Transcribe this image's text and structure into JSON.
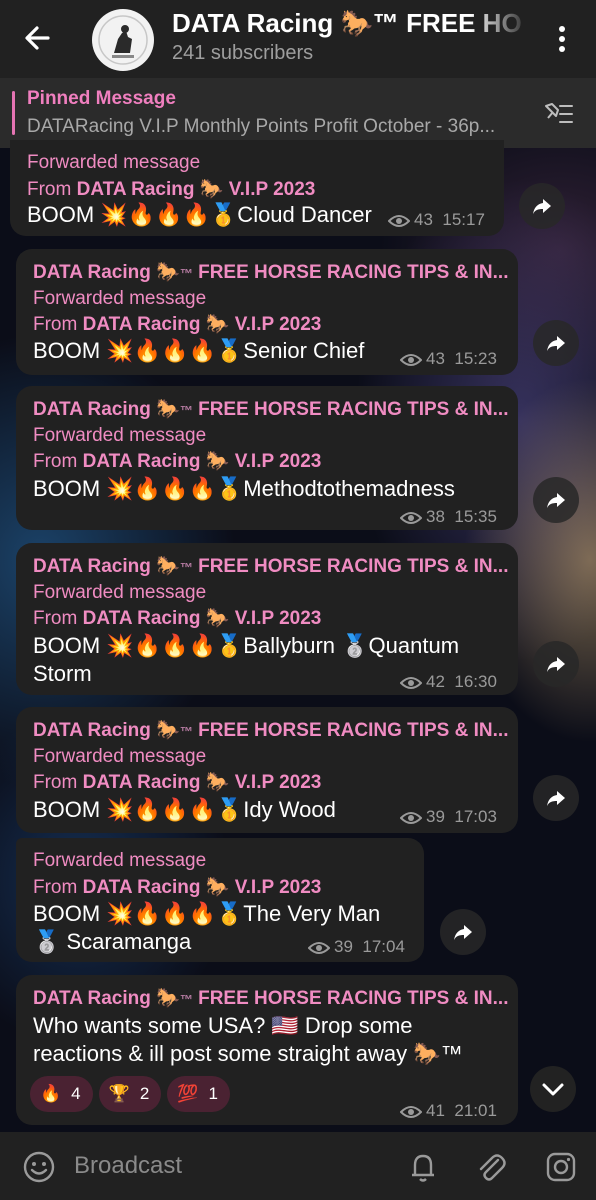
{
  "header": {
    "title": "DATA Racing 🐎™ FREE HORSE RACING TIPS & INFO",
    "subscribers": "241 subscribers"
  },
  "pinned": {
    "label": "Pinned Message",
    "text": "DATARacing V.I.P Monthly Points Profit  October - 36p..."
  },
  "channel_name": "DATA Racing",
  "channel_suffix": "FREE HORSE RACING TIPS & IN...",
  "forward_label": "Forwarded message",
  "from_prefix": "From",
  "from_source": "DATA Racing",
  "from_suffix": "V.I.P 2023",
  "messages": [
    {
      "body": "BOOM 💥🔥🔥🔥🥇Cloud Dancer",
      "views": "43",
      "time": "15:17"
    },
    {
      "body": "BOOM 💥🔥🔥🔥🥇Senior Chief",
      "views": "43",
      "time": "15:23"
    },
    {
      "body": "BOOM 💥🔥🔥🔥🥇Methodtothemadness",
      "views": "38",
      "time": "15:35"
    },
    {
      "body": "BOOM 💥🔥🔥🔥🥇Ballyburn 🥈Quantum Storm",
      "views": "42",
      "time": "16:30"
    },
    {
      "body": "BOOM 💥🔥🔥🔥🥇Idy Wood",
      "views": "39",
      "time": "17:03"
    },
    {
      "body": "BOOM 💥🔥🔥🔥🥇The Very Man 🥈 Scaramanga",
      "views": "39",
      "time": "17:04"
    },
    {
      "body": "Who wants some USA? 🇺🇸 Drop some reactions & ill post some straight away 🐎™",
      "views": "41",
      "time": "21:01"
    }
  ],
  "reactions": [
    {
      "emoji": "🔥",
      "count": "4"
    },
    {
      "emoji": "🏆",
      "count": "2"
    },
    {
      "emoji": "💯",
      "count": "1"
    }
  ],
  "composer": {
    "placeholder": "Broadcast"
  },
  "icons": [
    "back-arrow-icon",
    "more-vert-icon",
    "pinned-list-icon",
    "share-icon",
    "eye-icon",
    "chevron-down-icon",
    "emoji-icon",
    "bell-icon",
    "attach-icon",
    "instagram-icon"
  ],
  "colors": {
    "accent": "#f08cc2",
    "bubble": "#212121",
    "header": "#212121"
  }
}
